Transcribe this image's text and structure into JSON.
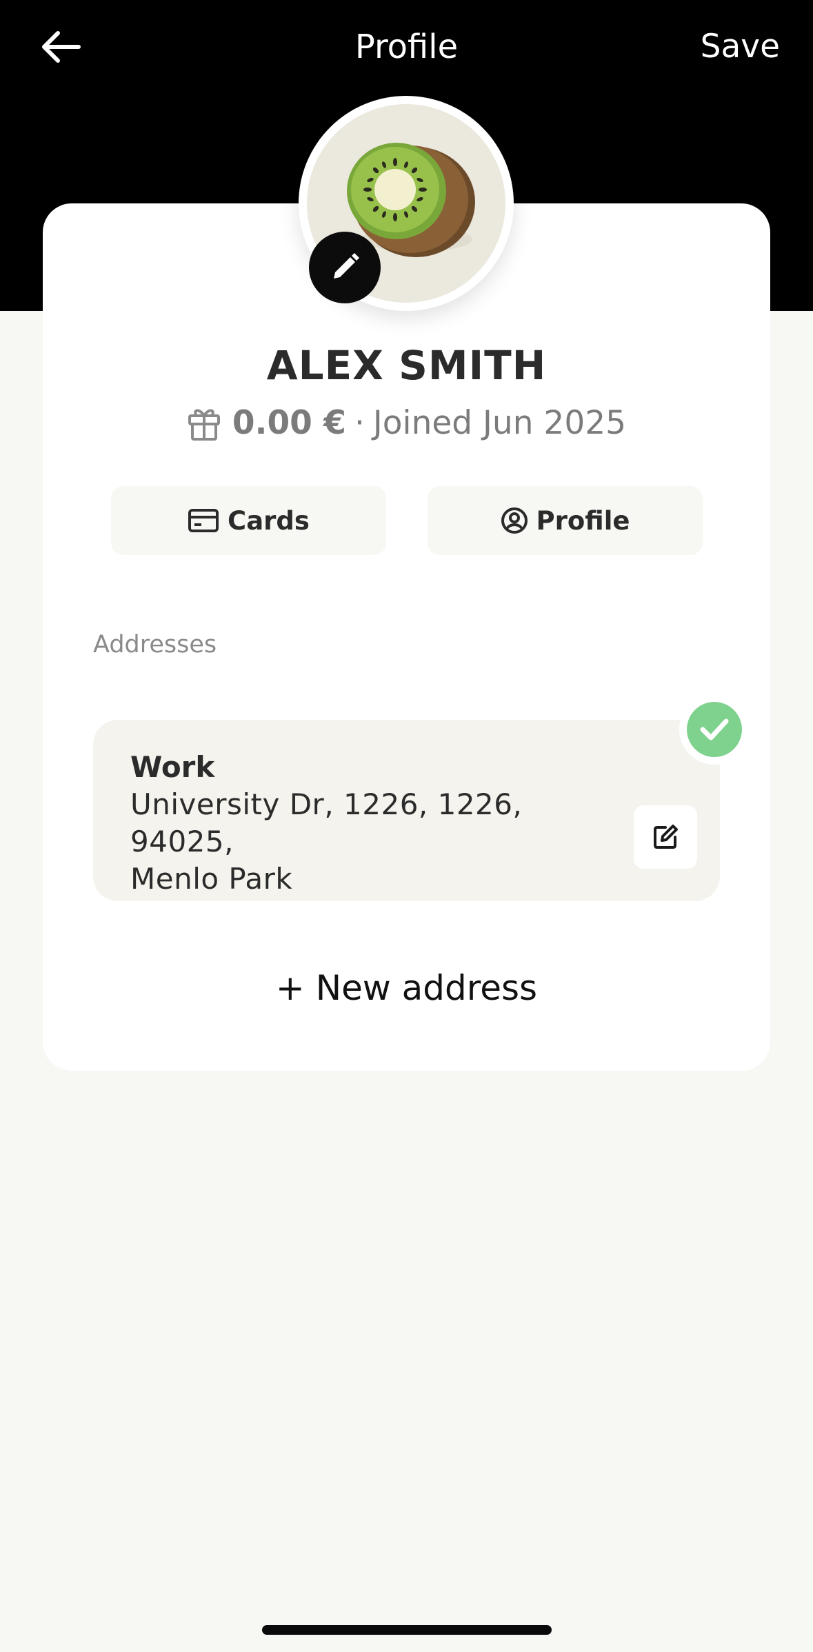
{
  "header": {
    "title": "Profile",
    "back_icon": "arrow-left-icon",
    "save_label": "Save"
  },
  "profile": {
    "avatar_icon": "kiwi-avatar",
    "edit_icon": "pencil-icon",
    "name": "ALEX SMITH",
    "gift_icon": "gift-icon",
    "balance": "0.00 €",
    "separator": "·",
    "joined": "Joined Jun 2025"
  },
  "actions": [
    {
      "label": "Cards",
      "icon": "credit-card-icon"
    },
    {
      "label": "Profile",
      "icon": "user-circle-icon"
    }
  ],
  "addresses": {
    "section_label": "Addresses",
    "items": [
      {
        "title": "Work",
        "line1": "University Dr, 1226, 1226, 94025,",
        "line2": "Menlo Park",
        "selected": true,
        "edit_icon": "edit-square-icon"
      }
    ],
    "new_label": "+ New address"
  },
  "colors": {
    "header_bg": "#000000",
    "page_bg": "#f7f7f3",
    "selected_check": "#7fd18e"
  }
}
